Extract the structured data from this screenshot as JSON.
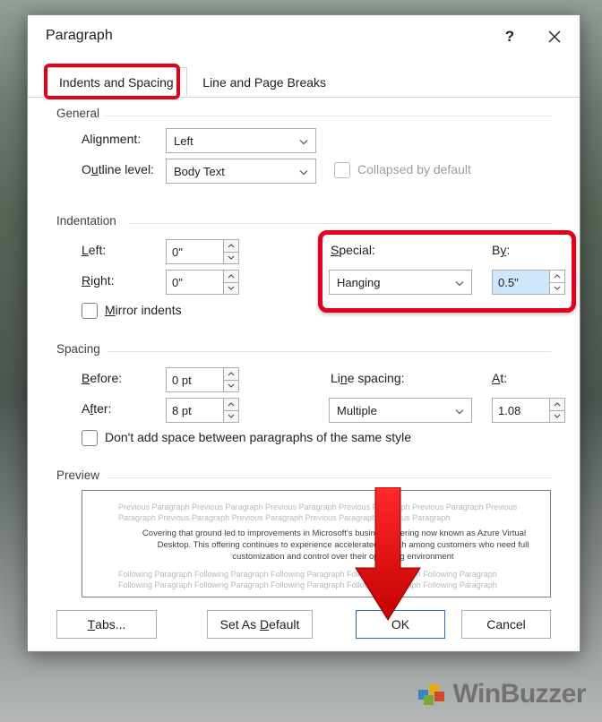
{
  "title": "Paragraph",
  "help_symbol": "?",
  "tabs": {
    "active": "Indents and Spacing",
    "other": "Line and Page Breaks"
  },
  "general": {
    "header": "General",
    "alignment_label": "Alignment:",
    "alignment_value": "Left",
    "outline_label_before": "O",
    "outline_underline": "u",
    "outline_label_after": "tline level:",
    "outline_value": "Body Text",
    "collapsed_label": "Collapsed by default"
  },
  "indentation": {
    "header": "Indentation",
    "left_underline": "L",
    "left_label_rest": "eft:",
    "left_value": "0\"",
    "right_underline": "R",
    "right_label_rest": "ight:",
    "right_value": "0\"",
    "special_underline": "S",
    "special_label_rest": "pecial:",
    "special_value": "Hanging",
    "by_label_before": "B",
    "by_underline": "y",
    "by_label_after": ":",
    "by_value": "0.5\"",
    "mirror_underline": "M",
    "mirror_label_rest": "irror indents"
  },
  "spacing": {
    "header": "Spacing",
    "before_underline": "B",
    "before_label_rest": "efore:",
    "before_value": "0 pt",
    "after_label_before": "A",
    "after_underline": "f",
    "after_label_after": "ter:",
    "after_value": "8 pt",
    "line_label_before": "Li",
    "line_underline": "n",
    "line_label_after": "e spacing:",
    "line_value": "Multiple",
    "at_underline": "A",
    "at_label_rest": "t:",
    "at_value": "1.08",
    "same_style_label": "Don't add space between paragraphs of the same style"
  },
  "preview": {
    "header": "Preview",
    "prev_text": "Previous Paragraph Previous Paragraph Previous Paragraph Previous Paragraph Previous Paragraph Previous Paragraph Previous Paragraph Previous Paragraph Previous Paragraph Previous Paragraph",
    "sample": "Covering that ground led to improvements in Microsoft's business offering now known as Azure Virtual Desktop. This offering continues to experience accelerated growth among customers who need full customization and control over their operating environment",
    "follow_text": "Following Paragraph Following Paragraph Following Paragraph Following Paragraph Following Paragraph Following Paragraph Following Paragraph Following Paragraph Following Paragraph Following Paragraph"
  },
  "buttons": {
    "tabs": "Tabs...",
    "default": "Set As Default",
    "ok": "OK",
    "cancel": "Cancel"
  },
  "watermark": "WinBuzzer"
}
